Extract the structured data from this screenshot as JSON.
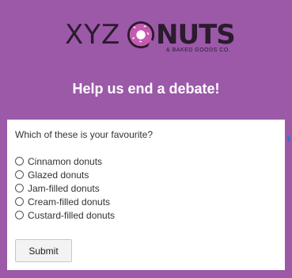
{
  "logo": {
    "prefix": "XYZ",
    "brand_rest": "NUTS",
    "tagline": "& BAKED GOODS CO.",
    "colors": {
      "text": "#2b1b2e",
      "icing": "#c55bb1",
      "dough": "#2b1b2e"
    }
  },
  "heading": "Help us end a debate!",
  "form": {
    "question": "Which of these is your favourite?",
    "options": [
      "Cinnamon donuts",
      "Glazed donuts",
      "Jam-filled donuts",
      "Cream-filled donuts",
      "Custard-filled donuts"
    ],
    "submit_label": "Submit"
  },
  "theme": {
    "background": "#9b59a8",
    "card": "#ffffff"
  }
}
